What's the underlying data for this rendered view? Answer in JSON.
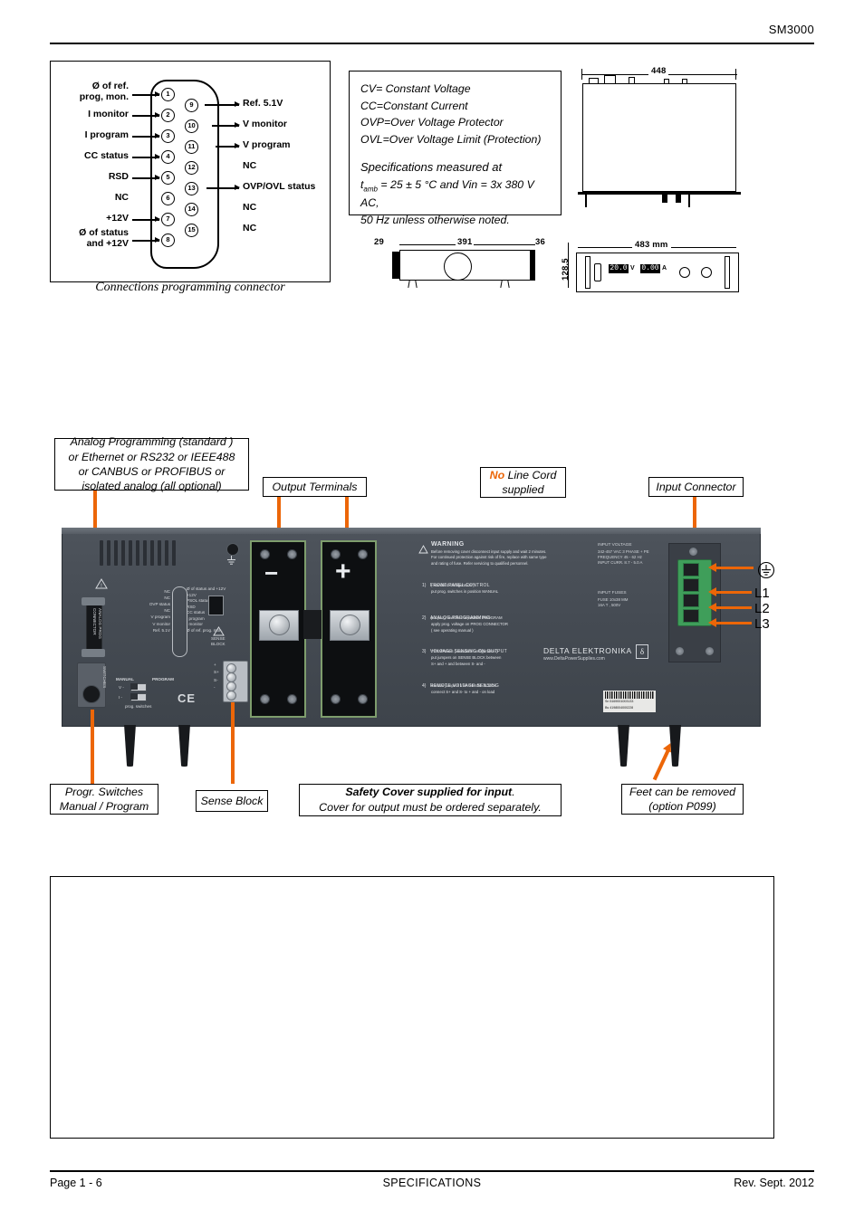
{
  "header": {
    "title": "SM3000"
  },
  "footer": {
    "page": "Page 1 - 6",
    "section": "SPECIFICATIONS",
    "revision": "Rev. Sept. 2012"
  },
  "connector_diagram": {
    "caption": "Connections programming connector",
    "left_pins": [
      {
        "num": "1",
        "label": "Ø  of ref.\nprog, mon.",
        "arrow": true
      },
      {
        "num": "2",
        "label": "I monitor",
        "arrow": true
      },
      {
        "num": "3",
        "label": "I program",
        "arrow": true
      },
      {
        "num": "4",
        "label": "CC status",
        "arrow": true
      },
      {
        "num": "5",
        "label": "RSD",
        "arrow": true
      },
      {
        "num": "6",
        "label": "NC",
        "arrow": false
      },
      {
        "num": "7",
        "label": "+12V",
        "arrow": true
      },
      {
        "num": "8",
        "label": "Ø of status\nand +12V",
        "arrow": true
      }
    ],
    "right_pins": [
      {
        "num": "9",
        "label": "Ref. 5.1V",
        "arrow": true
      },
      {
        "num": "10",
        "label": "V monitor",
        "arrow": true
      },
      {
        "num": "11",
        "label": "V program",
        "arrow": true
      },
      {
        "num": "12",
        "label": "NC",
        "arrow": false
      },
      {
        "num": "13",
        "label": "OVP/OVL status",
        "arrow": true
      },
      {
        "num": "14",
        "label": "NC",
        "arrow": false
      },
      {
        "num": "15",
        "label": "NC",
        "arrow": false
      }
    ]
  },
  "spec_legend": {
    "lines": [
      "CV= Constant Voltage",
      "CC=Constant Current",
      "OVP=Over Voltage Protector",
      "OVL=Over Voltage Limit (Protection)"
    ],
    "measured_title": "Specifications measured at",
    "measured_prefix": "t",
    "measured_sub": "amb",
    "measured_line1": " = 25 ± 5 °C and Vin = 3x 380 V AC,",
    "measured_line2": "50 Hz unless otherwise noted."
  },
  "mechanical": {
    "top_width": "448",
    "front_width": "483 mm",
    "side_front": "29",
    "side_length": "391",
    "side_rear": "36",
    "side_height": "128.5",
    "front_display_v": "20.0",
    "front_display_v_unit": "V",
    "front_display_a": "0.00",
    "front_display_a_unit": "A"
  },
  "callouts": {
    "analog_programming": "Analog Programming (standard )\nor  Ethernet or RS232 or IEEE488\nor  CANBUS or PROFIBUS or\nisolated analog (all optional)",
    "output_terminals": "Output Terminals",
    "no_line_cord_em": "No",
    "no_line_cord_rest": " Line Cord\nsupplied",
    "input_connector": "Input Connector",
    "progr_switches": "Progr. Switches\nManual / Program",
    "sense_block": "Sense Block",
    "safety_cover_bold": "Safety Cover supplied for input",
    "safety_cover_rest": ".\nCover for output must be ordered separately.",
    "feet": "Feet  can be removed\n(option P099)"
  },
  "phase_labels": [
    "L1",
    "L2",
    "L3"
  ],
  "panel": {
    "analog_conn_text": "ANALOG PROG\nCONNECTOR",
    "switches_text": "SWITCHES",
    "manual_label": "MANUAL",
    "program_label": "PROGRAM",
    "switch_v": "V  -",
    "switch_i": "I  -",
    "prog_switches_caption": "prog. switches",
    "ce_mark": "CE",
    "sense_block_label": "SENSE\nBLOCK",
    "sense_terms": [
      "+",
      "S+",
      "S-",
      "-"
    ],
    "pinout_left": [
      "NC",
      "NC",
      "OVP status",
      "NC",
      "V program",
      "V monitor",
      "Ref. 5.1V"
    ],
    "pinout_left_nums": [
      "15",
      "14",
      "13",
      "12",
      "11",
      "10",
      "9"
    ],
    "pinout_right_nums": [
      "8",
      "7",
      "6",
      "5",
      "4",
      "3",
      "2",
      "1"
    ],
    "pinout_right": [
      "Ø of status and +12V",
      "+12V",
      "PSOL status",
      "RSD",
      "CC status",
      "I program",
      "I monitor",
      "Ø of ref. prog. mon."
    ],
    "warning_title": "WARNING",
    "warning_body": "Before removing cover disconnect input supply and wait 2 minutes.\nFor continued protection against risk of fire, replace with same type\nand rating of fuse.  Refer servicing to qualified personnel.",
    "instructions": [
      {
        "num": "1)",
        "title": "FRONT PANEL  CONTROL",
        "body": "( standard configuration )\nput prog. switches in position  MANUAL"
      },
      {
        "num": "2)",
        "title": "ANALOG  PROGRAMMING",
        "body": "put prog. switches in position PROGRAM\napply prog. voltage on PROG CONNECTOR\n( see operating manual )"
      },
      {
        "num": "3)",
        "title": "VOLTAGE  SENSING  ON  OUTPUT",
        "body": "TERMINALS ( standard configuration )\nput jumpers on SENSE BLOCK between\nS+ and + and between S- and -"
      },
      {
        "num": "4)",
        "title": "REMOTE  VOLTAGE  SENSING",
        "body": "remove jumpers from  SENSE BLOCK\nconnect S+ and S- to + and - on load"
      }
    ],
    "brand": "DELTA  ELEKTRONIKA",
    "website": "www.DeltaPowerSupplies.com",
    "input_voltage_title": "INPUT VOLTAGE",
    "input_voltage_lines": "342-457 VAC 3 PHASE + PE\nFREQUENCY 45 - 62 Hz\nINPUT CURR. 8.7 - 5.0 A",
    "input_fuses_title": "INPUT FUSES",
    "input_fuses_lines": "FUSE  10x38 MM\n16A T , 500V",
    "serial_line1": "Sn 5169001003133",
    "serial_line2": "Bs 4198004000228",
    "output_minus": "−",
    "output_plus": "+"
  },
  "colors": {
    "accent": "#EC6608",
    "panel": "#4a5058",
    "terminal_green": "#3f9e5a"
  }
}
